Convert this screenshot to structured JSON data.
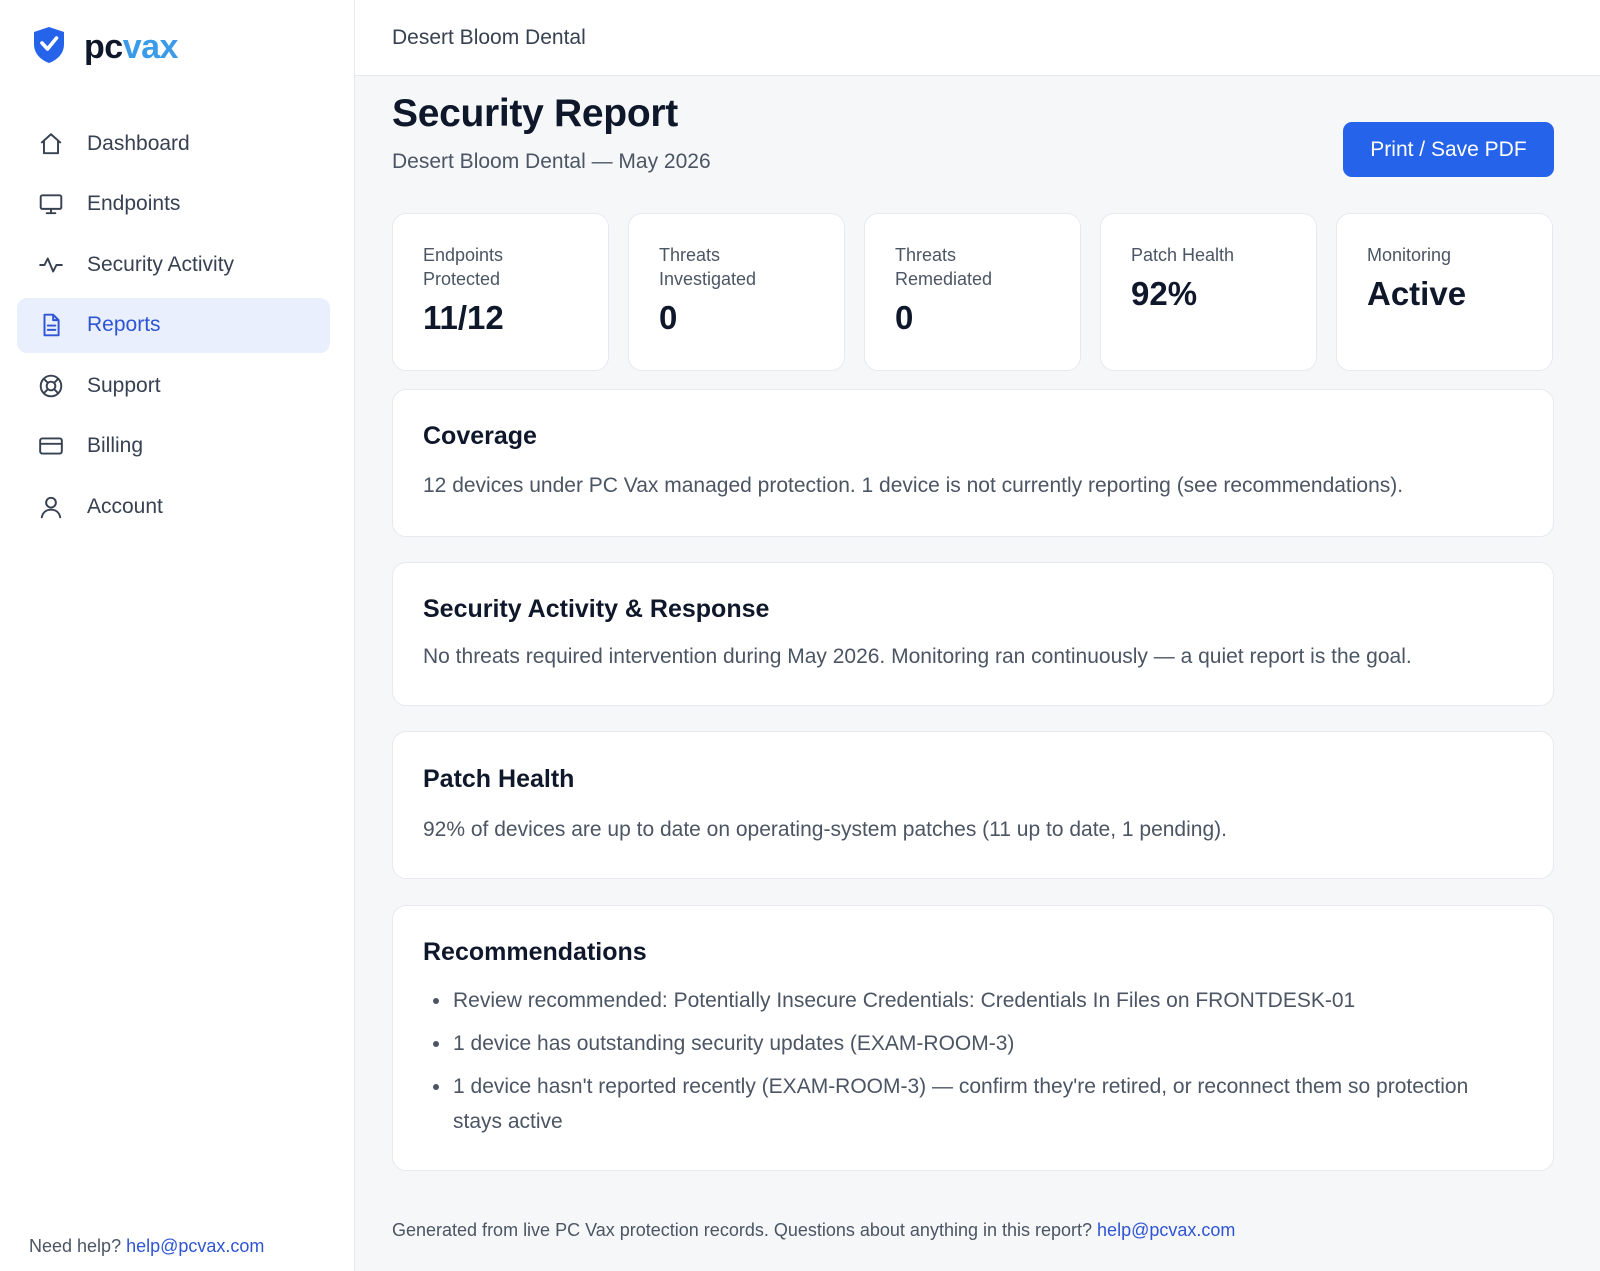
{
  "brand": {
    "name_part1": "pc",
    "name_part2": "vax",
    "accent": "#2563eb"
  },
  "sidebar": {
    "items": [
      {
        "label": "Dashboard",
        "icon": "home-icon",
        "active": false
      },
      {
        "label": "Endpoints",
        "icon": "monitor-icon",
        "active": false
      },
      {
        "label": "Security Activity",
        "icon": "activity-icon",
        "active": false
      },
      {
        "label": "Reports",
        "icon": "document-icon",
        "active": true
      },
      {
        "label": "Support",
        "icon": "lifebuoy-icon",
        "active": false
      },
      {
        "label": "Billing",
        "icon": "credit-card-icon",
        "active": false
      },
      {
        "label": "Account",
        "icon": "user-icon",
        "active": false
      }
    ],
    "help_text": "Need help?",
    "help_email": "help@pcvax.com"
  },
  "header": {
    "org_name": "Desert Bloom Dental"
  },
  "report": {
    "title": "Security Report",
    "subtitle": "Desert Bloom Dental — May 2026",
    "print_button": "Print / Save PDF"
  },
  "stats": [
    {
      "label_line1": "Endpoints",
      "label_line2": "Protected",
      "value": "11/12"
    },
    {
      "label_line1": "Threats",
      "label_line2": "Investigated",
      "value": "0"
    },
    {
      "label_line1": "Threats",
      "label_line2": "Remediated",
      "value": "0"
    },
    {
      "label_line1": "Patch Health",
      "label_line2": "",
      "value": "92%"
    },
    {
      "label_line1": "Monitoring",
      "label_line2": "",
      "value": "Active"
    }
  ],
  "sections": {
    "coverage": {
      "title": "Coverage",
      "body": "12 devices under PC Vax managed protection. 1 device is not currently reporting (see recommendations)."
    },
    "activity": {
      "title": "Security Activity & Response",
      "body": "No threats required intervention during May 2026. Monitoring ran continuously — a quiet report is the goal."
    },
    "patch": {
      "title": "Patch Health",
      "body": "92% of devices are up to date on operating-system patches (11 up to date, 1 pending)."
    },
    "recommendations": {
      "title": "Recommendations",
      "items": [
        "Review recommended: Potentially Insecure Credentials: Credentials In Files on FRONTDESK-01",
        "1 device has outstanding security updates (EXAM-ROOM-3)",
        "1 device hasn't reported recently (EXAM-ROOM-3) — confirm they're retired, or reconnect them so protection stays active"
      ]
    }
  },
  "footer": {
    "text": "Generated from live PC Vax protection records. Questions about anything in this report?",
    "email": "help@pcvax.com"
  }
}
